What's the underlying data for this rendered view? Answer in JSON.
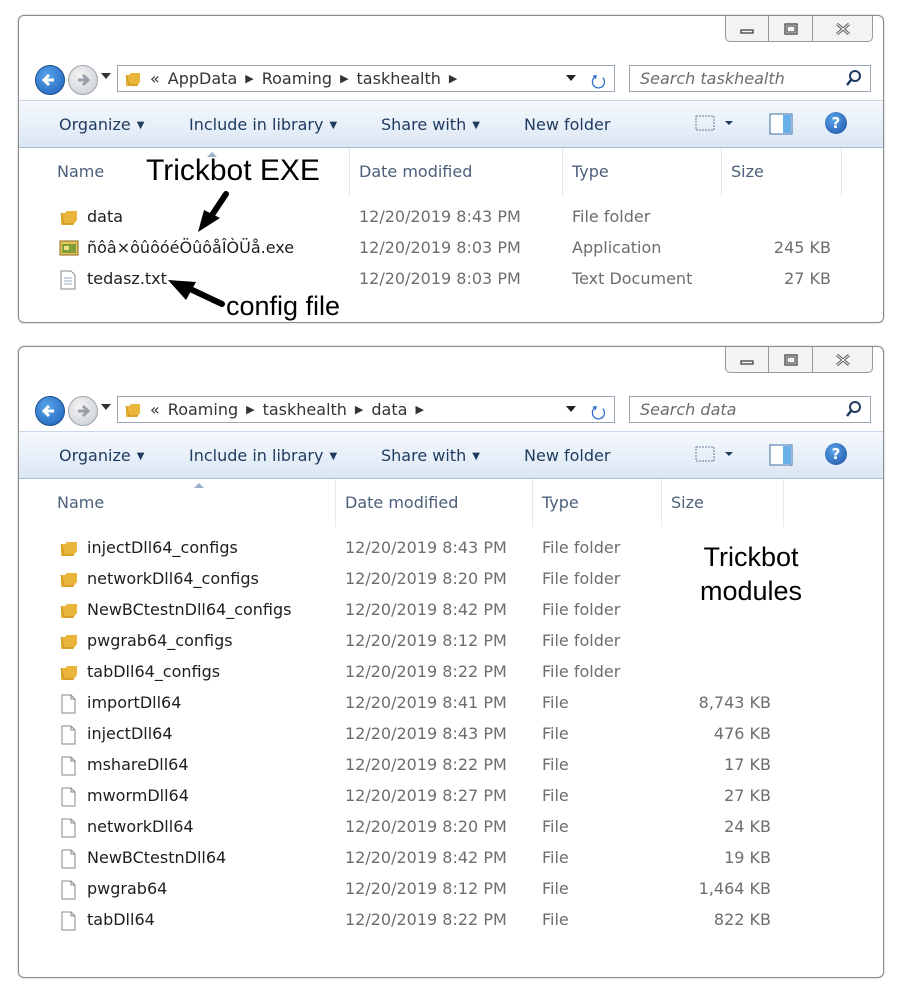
{
  "window1": {
    "breadcrumb": {
      "prefix": "«",
      "parts": [
        "AppData",
        "Roaming",
        "taskhealth"
      ]
    },
    "search_placeholder": "Search taskhealth",
    "toolbar": {
      "organize": "Organize",
      "include": "Include in library",
      "share": "Share with",
      "newfolder": "New folder"
    },
    "columns": {
      "name": "Name",
      "date": "Date modified",
      "type": "Type",
      "size": "Size"
    },
    "files": [
      {
        "name": "data",
        "date": "12/20/2019 8:43 PM",
        "type": "File folder",
        "size": "",
        "icon": "folder-icon"
      },
      {
        "name": "ñôâ×ôûôóéÖûôåÎÒÜå.exe",
        "date": "12/20/2019 8:03 PM",
        "type": "Application",
        "size": "245 KB",
        "icon": "application-icon"
      },
      {
        "name": "tedasz.txt",
        "date": "12/20/2019 8:03 PM",
        "type": "Text Document",
        "size": "27 KB",
        "icon": "text-document-icon"
      }
    ],
    "annotations": {
      "exe": "Trickbot  EXE",
      "config": "config file"
    }
  },
  "window2": {
    "breadcrumb": {
      "prefix": "«",
      "parts": [
        "Roaming",
        "taskhealth",
        "data"
      ]
    },
    "search_placeholder": "Search data",
    "toolbar": {
      "organize": "Organize",
      "include": "Include in library",
      "share": "Share with",
      "newfolder": "New folder"
    },
    "columns": {
      "name": "Name",
      "date": "Date modified",
      "type": "Type",
      "size": "Size"
    },
    "files": [
      {
        "name": "injectDll64_configs",
        "date": "12/20/2019 8:43 PM",
        "type": "File folder",
        "size": "",
        "icon": "folder-icon"
      },
      {
        "name": "networkDll64_configs",
        "date": "12/20/2019 8:20 PM",
        "type": "File folder",
        "size": "",
        "icon": "folder-icon"
      },
      {
        "name": "NewBCtestnDll64_configs",
        "date": "12/20/2019 8:42 PM",
        "type": "File folder",
        "size": "",
        "icon": "folder-icon"
      },
      {
        "name": "pwgrab64_configs",
        "date": "12/20/2019 8:12 PM",
        "type": "File folder",
        "size": "",
        "icon": "folder-icon"
      },
      {
        "name": "tabDll64_configs",
        "date": "12/20/2019 8:22 PM",
        "type": "File folder",
        "size": "",
        "icon": "folder-icon"
      },
      {
        "name": "importDll64",
        "date": "12/20/2019 8:41 PM",
        "type": "File",
        "size": "8,743 KB",
        "icon": "file-icon"
      },
      {
        "name": "injectDll64",
        "date": "12/20/2019 8:43 PM",
        "type": "File",
        "size": "476 KB",
        "icon": "file-icon"
      },
      {
        "name": "mshareDll64",
        "date": "12/20/2019 8:22 PM",
        "type": "File",
        "size": "17 KB",
        "icon": "file-icon"
      },
      {
        "name": "mwormDll64",
        "date": "12/20/2019 8:27 PM",
        "type": "File",
        "size": "27 KB",
        "icon": "file-icon"
      },
      {
        "name": "networkDll64",
        "date": "12/20/2019 8:20 PM",
        "type": "File",
        "size": "24 KB",
        "icon": "file-icon"
      },
      {
        "name": "NewBCtestnDll64",
        "date": "12/20/2019 8:42 PM",
        "type": "File",
        "size": "19 KB",
        "icon": "file-icon"
      },
      {
        "name": "pwgrab64",
        "date": "12/20/2019 8:12 PM",
        "type": "File",
        "size": "1,464 KB",
        "icon": "file-icon"
      },
      {
        "name": "tabDll64",
        "date": "12/20/2019 8:22 PM",
        "type": "File",
        "size": "822 KB",
        "icon": "file-icon"
      }
    ],
    "annotations": {
      "modules_line1": "Trickbot",
      "modules_line2": "modules"
    }
  },
  "colors": {
    "command_bar": "#dbe6f4",
    "folder": "#e9b53a",
    "link_blue": "#2a6fc9"
  }
}
